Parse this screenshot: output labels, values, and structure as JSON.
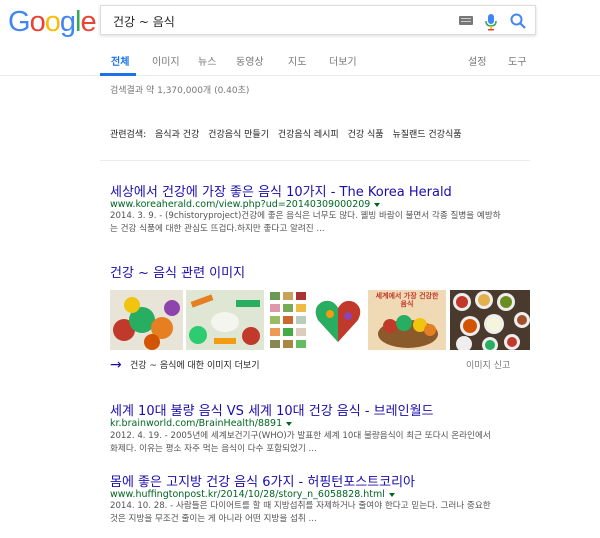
{
  "logo": [
    "G",
    "o",
    "o",
    "g",
    "l",
    "e"
  ],
  "logo_colors": [
    "#4285f4",
    "#ea4335",
    "#fbbc05",
    "#4285f4",
    "#34a853",
    "#ea4335"
  ],
  "search": {
    "query": "건강 ~ 음식"
  },
  "tabs": [
    {
      "label": "전체",
      "active": true
    },
    {
      "label": "이미지"
    },
    {
      "label": "뉴스"
    },
    {
      "label": "동영상"
    },
    {
      "label": "지도"
    },
    {
      "label": "더보기"
    },
    {
      "label": "설정"
    },
    {
      "label": "도구"
    }
  ],
  "stats": "검색결과 약 1,370,000개 (0.40초)",
  "related": {
    "prefix": "관련검색:",
    "links": [
      "음식과 건강",
      "건강음식 만들기",
      "건강음식 레시피",
      "건강 식품",
      "뉴질랜드 건강식품"
    ]
  },
  "results": [
    {
      "title": "세상에서 건강에 가장 좋은 음식 10가지 - The Korea Herald",
      "url": "www.koreaherald.com/view.php?ud=20140309000209",
      "snippet1": "2014. 3. 9. - (9chistoryproject)건강에 좋은 음식은 너무도 많다. 웰빙 바람이 불면서 각종 질병을 예방하",
      "snippet2": "는 건강 식품에 대한 관심도 뜨겁다.하지만 좋다고 알려진 ..."
    },
    {
      "title": "세계 10대 불량 음식 VS 세계 10대 건강 음식 - 브레인월드",
      "url": "kr.brainworld.com/BrainHealth/8891",
      "snippet1": "2012. 4. 19. - 2005년에 세계보건기구(WHO)가 발표한 세계 10대 불량음식이 최근 또다시 온라인에서",
      "snippet2": "화제다. 이유는 평소 자주 먹는 음식이 다수 포함되었기 ..."
    },
    {
      "title": "몸에 좋은 고지방 건강 음식 6가지 - 허핑턴포스트코리아",
      "url": "www.huffingtonpost.kr/2014/10/28/story_n_6058828.html",
      "snippet1": "2014. 10. 28. - 사람들은 다이어트를 할 때 지방섭취를 자제하거나 줄여야 한다고 믿는다. 그러나 중요한",
      "snippet2": "것은 지방을 무조건 줄이는 게 아니라 어떤 지방을 섭취 ..."
    }
  ],
  "images": {
    "heading": "건강 ~ 음식 관련 이미지",
    "thumb_text": "세계에서 가장 건강한 음식",
    "more": "건강 ~ 음식에 대한 이미지 더보기",
    "report": "이미지 신고"
  },
  "colors": {
    "link": "#1a0dab",
    "url": "#006621",
    "accent": "#1a73e8",
    "snippet": "#545454"
  }
}
